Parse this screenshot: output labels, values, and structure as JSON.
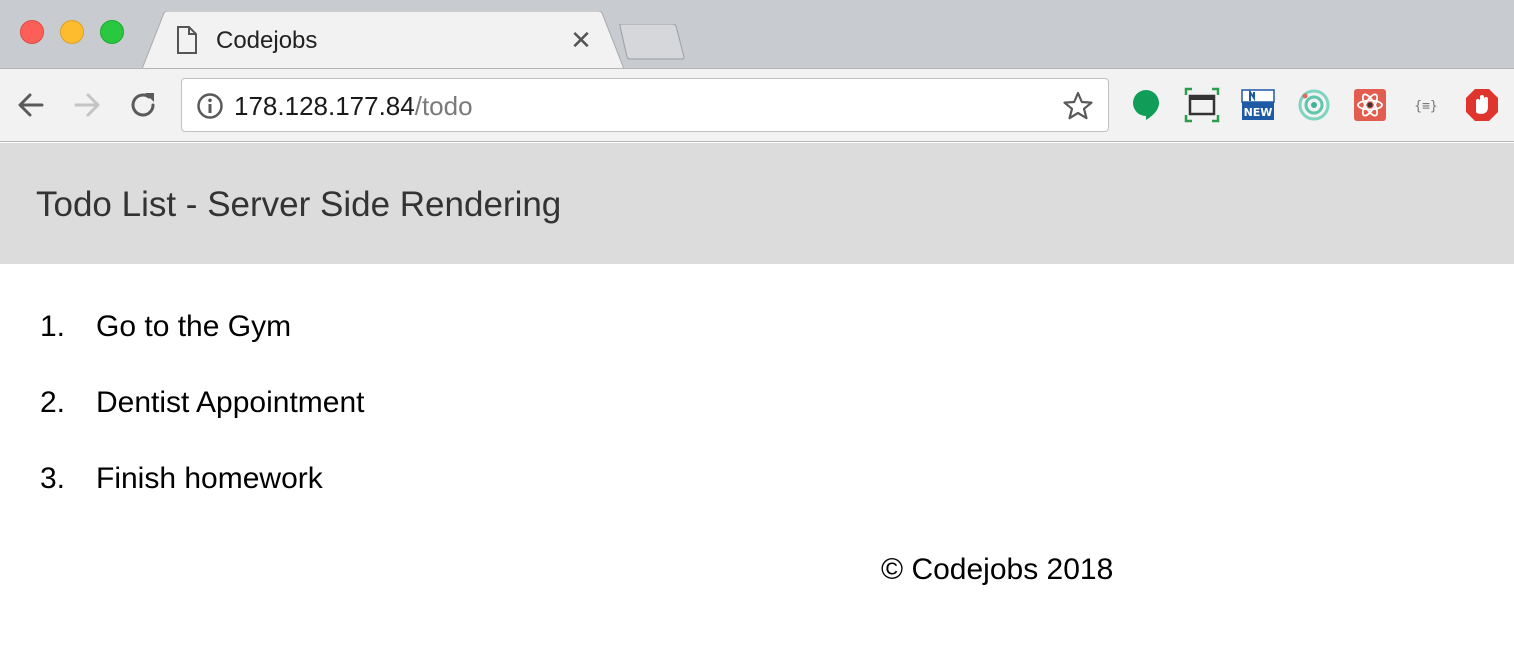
{
  "browser": {
    "tab": {
      "title": "Codejobs",
      "close_glyph": "✕",
      "icon": "document-icon"
    },
    "address_bar": {
      "host": "178.128.177.84",
      "path": "/todo",
      "icon": "info-icon"
    },
    "extensions": [
      "hangouts-icon",
      "screen-capture-icon",
      "new-badge-icon",
      "target-icon",
      "react-devtools-icon",
      "json-formatter-icon",
      "adblock-icon"
    ]
  },
  "page": {
    "header_title": "Todo List - Server Side Rendering",
    "todos": [
      {
        "number": "1.",
        "text": "Go to the Gym"
      },
      {
        "number": "2.",
        "text": "Dentist Appointment"
      },
      {
        "number": "3.",
        "text": "Finish homework"
      }
    ],
    "footer": "© Codejobs 2018"
  },
  "colors": {
    "header_bg": "#dcdcdc",
    "tabstrip_bg": "#c8cbcf",
    "toolbar_bg": "#f2f2f2"
  }
}
